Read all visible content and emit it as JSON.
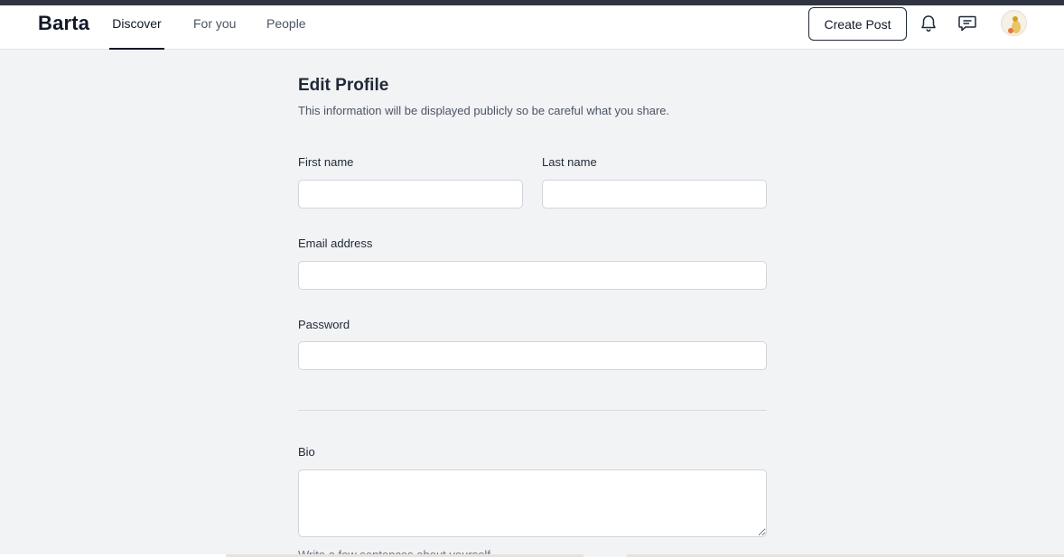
{
  "app": {
    "brand": "Barta"
  },
  "nav": {
    "tabs": [
      {
        "label": "Discover",
        "active": true
      },
      {
        "label": "For you",
        "active": false
      },
      {
        "label": "People",
        "active": false
      }
    ],
    "create_post_label": "Create Post",
    "icons": [
      "bell-icon",
      "chat-icon"
    ]
  },
  "form": {
    "title": "Edit Profile",
    "subtitle": "This information will be displayed publicly so be careful what you share.",
    "first_name": {
      "label": "First name",
      "value": ""
    },
    "last_name": {
      "label": "Last name",
      "value": ""
    },
    "email": {
      "label": "Email address",
      "value": ""
    },
    "password": {
      "label": "Password",
      "value": ""
    },
    "bio": {
      "label": "Bio",
      "value": "",
      "helper": "Write a few sentences about yourself."
    }
  },
  "colors": {
    "accent": "#111827",
    "background": "#f2f3f5",
    "topbar": "#2f3441"
  }
}
